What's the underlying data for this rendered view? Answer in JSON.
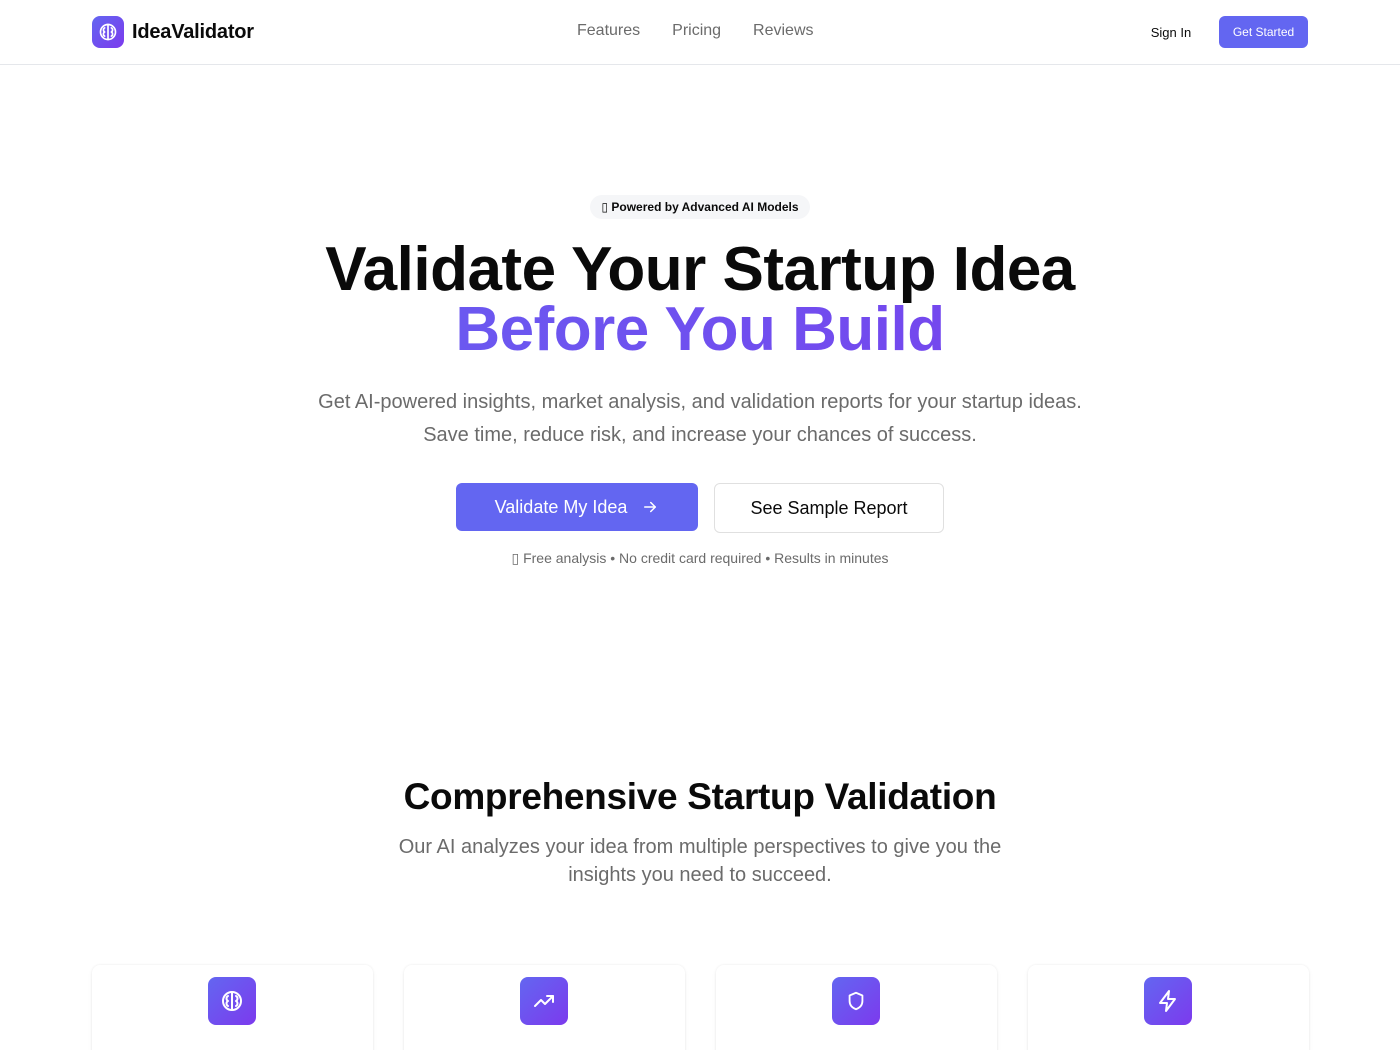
{
  "header": {
    "brand_name": "IdeaValidator",
    "nav": [
      "Features",
      "Pricing",
      "Reviews"
    ],
    "sign_in": "Sign In",
    "get_started": "Get Started"
  },
  "hero": {
    "badge": "▯ Powered by Advanced AI Models",
    "title_line1": "Validate Your Startup Idea",
    "title_line2": "Before You Build",
    "subtitle": "Get AI-powered insights, market analysis, and validation reports for your startup ideas. Save time, reduce risk, and increase your chances of success.",
    "primary_cta": "Validate My Idea",
    "secondary_cta": "See Sample Report",
    "note": "▯ Free analysis • No credit card required • Results in minutes"
  },
  "features": {
    "title": "Comprehensive Startup Validation",
    "subtitle": "Our AI analyzes your idea from multiple perspectives to give you the insights you need to succeed.",
    "cards": [
      {
        "icon": "brain-icon"
      },
      {
        "icon": "trending-up-icon"
      },
      {
        "icon": "shield-icon"
      },
      {
        "icon": "lightning-icon"
      }
    ]
  },
  "colors": {
    "accent": "#6366f1",
    "accent_end": "#7c3aed",
    "muted_text": "#6b6b6b",
    "border": "#e5e7eb"
  }
}
